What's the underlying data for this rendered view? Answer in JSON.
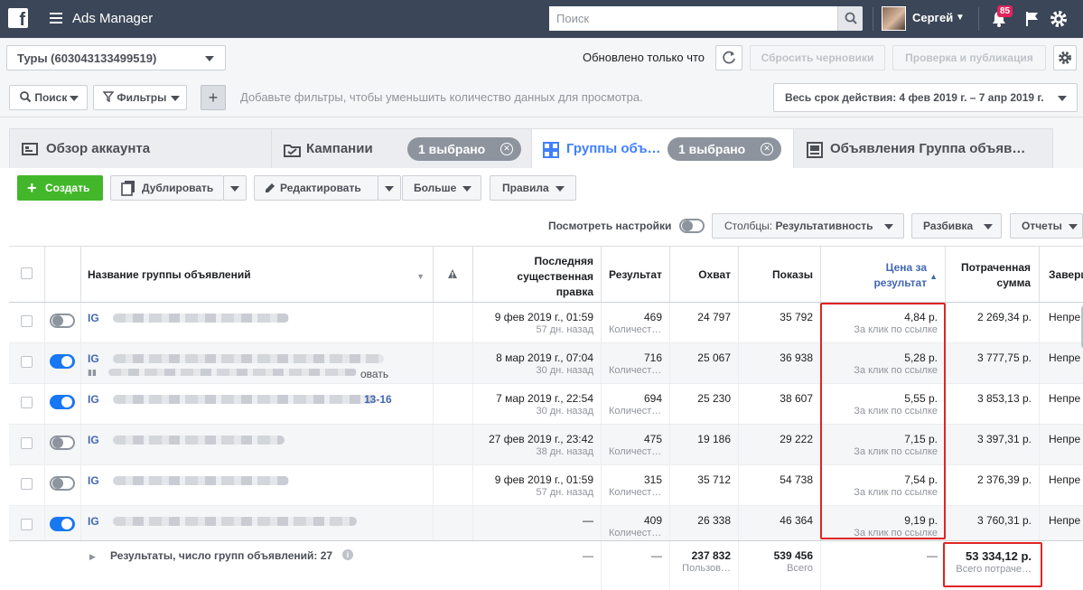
{
  "topbar": {
    "logo": "f",
    "title": "Ads Manager",
    "search_placeholder": "Поиск",
    "user_name": "Сергей",
    "notifications": "85"
  },
  "account_bar": {
    "account_label": "Туры (603043133499519)",
    "updated_text": "Обновлено только что",
    "discard_label": "Сбросить черновики",
    "review_label": "Проверка и публикация"
  },
  "filter_bar": {
    "search_label": "Поиск",
    "filters_label": "Фильтры",
    "hint": "Добавьте фильтры, чтобы уменьшить количество данных для просмотра.",
    "date_range": "Весь срок действия: 4 фев 2019 г. – 7 апр 2019 г."
  },
  "tabs": {
    "overview": "Обзор аккаунта",
    "campaigns": "Кампании",
    "campaigns_selected": "1 выбрано",
    "adsets": "Группы объ…",
    "adsets_selected": "1 выбрано",
    "ads": "Объявления Группа объяв…"
  },
  "toolbar": {
    "create": "Создать",
    "duplicate": "Дублировать",
    "edit": "Редактировать",
    "more": "Больше",
    "rules": "Правила",
    "view_settings": "Посмотреть настройки",
    "columns_prefix": "Столбцы: ",
    "columns_value": "Результативность",
    "breakdown": "Разбивка",
    "reports": "Отчеты"
  },
  "table": {
    "headers": {
      "name": "Название группы объявлений",
      "last_edit_1": "Последняя",
      "last_edit_2": "существенная",
      "last_edit_3": "правка",
      "results": "Результат",
      "reach": "Охват",
      "impressions": "Показы",
      "cpr_1": "Цена за",
      "cpr_2": "результат",
      "spent_1": "Потраченная",
      "spent_2": "сумма",
      "end": "Заверш"
    },
    "rows": [
      {
        "on": false,
        "name": "IG",
        "name_suffix": "",
        "edit_date": "9 фев 2019 г., 01:59",
        "edit_ago": "57 дн. назад",
        "results": "469",
        "results_sub": "Количест…",
        "reach": "24 797",
        "impressions": "35 792",
        "cpr": "4,84 р.",
        "cpr_sub": "За клик по ссылке",
        "spent": "2 269,34 р.",
        "end": "Непре"
      },
      {
        "on": true,
        "name": "IG",
        "name_suffix": "овать",
        "edit_date": "8 мар 2019 г., 07:04",
        "edit_ago": "30 дн. назад",
        "results": "716",
        "results_sub": "Количест…",
        "reach": "25 067",
        "impressions": "36 938",
        "cpr": "5,28 р.",
        "cpr_sub": "За клик по ссылке",
        "spent": "3 777,75 р.",
        "end": "Непре"
      },
      {
        "on": true,
        "name": "IG",
        "name_suffix": "13-16",
        "edit_date": "7 мар 2019 г., 22:54",
        "edit_ago": "30 дн. назад",
        "results": "694",
        "results_sub": "Количест…",
        "reach": "25 230",
        "impressions": "38 607",
        "cpr": "5,55 р.",
        "cpr_sub": "За клик по ссылке",
        "spent": "3 853,13 р.",
        "end": "Непре"
      },
      {
        "on": false,
        "name": "IG",
        "name_suffix": "",
        "edit_date": "27 фев 2019 г., 23:42",
        "edit_ago": "38 дн. назад",
        "results": "475",
        "results_sub": "Количест…",
        "reach": "19 186",
        "impressions": "29 222",
        "cpr": "7,15 р.",
        "cpr_sub": "За клик по ссылке",
        "spent": "3 397,31 р.",
        "end": "Непре"
      },
      {
        "on": false,
        "name": "IG",
        "name_suffix": "",
        "edit_date": "9 фев 2019 г., 01:59",
        "edit_ago": "57 дн. назад",
        "results": "315",
        "results_sub": "Количест…",
        "reach": "35 712",
        "impressions": "54 738",
        "cpr": "7,54 р.",
        "cpr_sub": "За клик по ссылке",
        "spent": "2 376,39 р.",
        "end": "Непре"
      },
      {
        "on": true,
        "name": "IG",
        "name_suffix": "",
        "edit_date": "—",
        "edit_ago": "",
        "results": "409",
        "results_sub": "Количест…",
        "reach": "26 338",
        "impressions": "46 364",
        "cpr": "9,19 р.",
        "cpr_sub": "За клик по ссылке",
        "spent": "3 760,31 р.",
        "end": "Непре"
      }
    ],
    "summary": {
      "label": "Результаты, число групп объявлений: 27",
      "last_edit": "—",
      "results": "—",
      "reach": "237 832",
      "reach_sub": "Пользов…",
      "impressions": "539 456",
      "impressions_sub": "Всего",
      "cpr": "—",
      "spent": "53 334,12 р.",
      "spent_sub": "Всего потраче…"
    }
  },
  "colors": {
    "topbar": "#3b4658",
    "create": "#42b72a",
    "toggle_on": "#1877f2",
    "highlight": "#e02424",
    "link": "#4267b2"
  }
}
